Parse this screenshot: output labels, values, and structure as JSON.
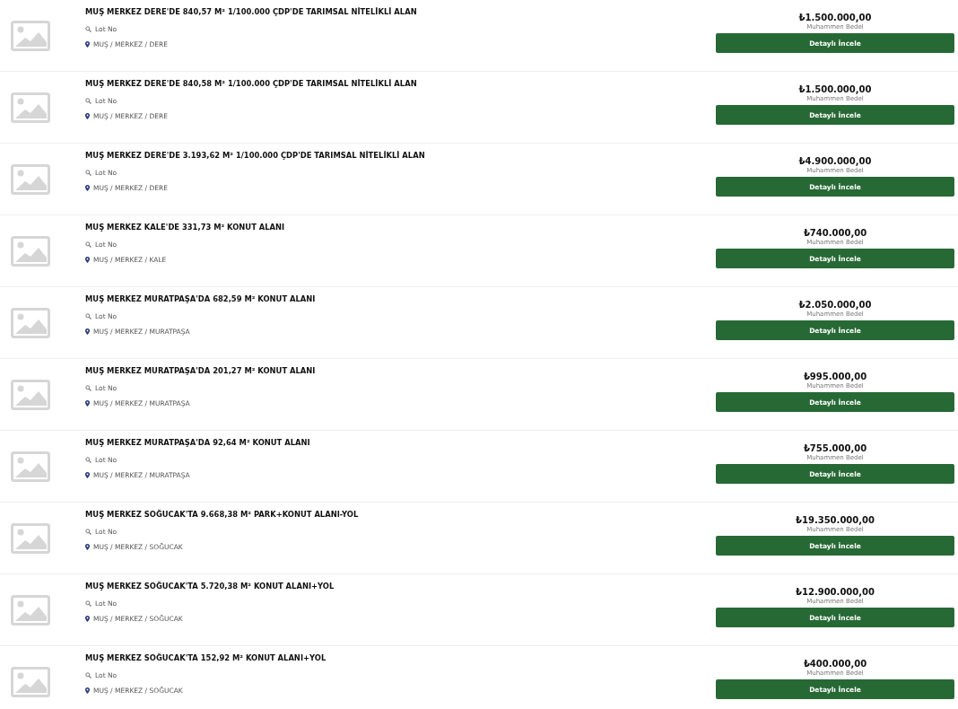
{
  "listings": [
    {
      "title": "MUŞ MERKEZ DERE'DE 840,57 M² 1/100.000 ÇDP'DE TARIMSAL NİTELİKLİ ALAN",
      "lot": "Lot No",
      "location": "MUŞ / MERKEZ / DERE",
      "price": "₺1.500.000,00",
      "price_label": "Muhammen Bedel",
      "button": "Detaylı İncele"
    },
    {
      "title": "MUŞ MERKEZ DERE'DE 840,58 M² 1/100.000 ÇDP'DE TARIMSAL NİTELİKLİ ALAN",
      "lot": "Lot No",
      "location": "MUŞ / MERKEZ / DERE",
      "price": "₺1.500.000,00",
      "price_label": "Muhammen Bedel",
      "button": "Detaylı İncele"
    },
    {
      "title": "MUŞ MERKEZ DERE'DE 3.193,62 M² 1/100.000 ÇDP'DE TARIMSAL NİTELİKLİ ALAN",
      "lot": "Lot No",
      "location": "MUŞ / MERKEZ / DERE",
      "price": "₺4.900.000,00",
      "price_label": "Muhammen Bedel",
      "button": "Detaylı İncele"
    },
    {
      "title": "MUŞ MERKEZ KALE'DE 331,73 M² KONUT ALANI",
      "lot": "Lot No",
      "location": "MUŞ / MERKEZ / KALE",
      "price": "₺740.000,00",
      "price_label": "Muhammen Bedel",
      "button": "Detaylı İncele"
    },
    {
      "title": "MUŞ MERKEZ MURATPAŞA'DA 682,59 M² KONUT ALANI",
      "lot": "Lot No",
      "location": "MUŞ / MERKEZ / MURATPAŞA",
      "price": "₺2.050.000,00",
      "price_label": "Muhammen Bedel",
      "button": "Detaylı İncele"
    },
    {
      "title": "MUŞ MERKEZ MURATPAŞA'DA 201,27 M² KONUT ALANI",
      "lot": "Lot No",
      "location": "MUŞ / MERKEZ / MURATPAŞA",
      "price": "₺995.000,00",
      "price_label": "Muhammen Bedel",
      "button": "Detaylı İncele"
    },
    {
      "title": "MUŞ MERKEZ MURATPAŞA'DA 92,64 M² KONUT ALANI",
      "lot": "Lot No",
      "location": "MUŞ / MERKEZ / MURATPAŞA",
      "price": "₺755.000,00",
      "price_label": "Muhammen Bedel",
      "button": "Detaylı İncele"
    },
    {
      "title": "MUŞ MERKEZ SOĞUCAK'TA 9.668,38 M² PARK+KONUT ALANI-YOL",
      "lot": "Lot No",
      "location": "MUŞ / MERKEZ / SOĞUCAK",
      "price": "₺19.350.000,00",
      "price_label": "Muhammen Bedel",
      "button": "Detaylı İncele"
    },
    {
      "title": "MUŞ MERKEZ SOĞUCAK'TA 5.720,38 M² KONUT ALANI+YOL",
      "lot": "Lot No",
      "location": "MUŞ / MERKEZ / SOĞUCAK",
      "price": "₺12.900.000,00",
      "price_label": "Muhammen Bedel",
      "button": "Detaylı İncele"
    },
    {
      "title": "MUŞ MERKEZ SOĞUCAK'TA 152,92 M² KONUT ALANI+YOL",
      "lot": "Lot No",
      "location": "MUŞ / MERKEZ / SOĞUCAK",
      "price": "₺400.000,00",
      "price_label": "Muhammen Bedel",
      "button": "Detaylı İncele"
    }
  ]
}
